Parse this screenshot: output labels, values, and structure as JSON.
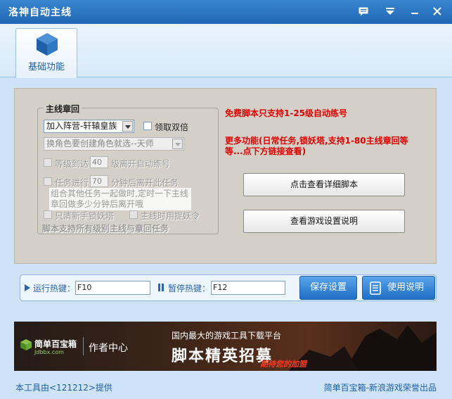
{
  "window": {
    "title": "洛神自动主线"
  },
  "tabs": [
    {
      "label": "基础功能"
    }
  ],
  "group": {
    "title": "主线章回",
    "camp_select": "加入阵营-轩辕皇族",
    "double_label": "领取双倍",
    "role_select": "换角色要创建角色就选--天师",
    "level_prefix": "等级到达",
    "level_value": "40",
    "level_suffix": "级离开自动练号",
    "task_prefix": "任务进行",
    "task_value": "70",
    "task_suffix": "分钟后离开此任务",
    "note": "组合其他任务一起做时,定时一下主线章回做多少分钟后离开哦",
    "only_lock_label": "只清新手锁妖塔",
    "catch_label": "主线时用捉妖令",
    "support_text": "脚本支持所有级别主线与章回任务"
  },
  "info": {
    "free_text": "免费脚本只支持1-25级自动练号",
    "more_text": "更多功能(日常任务,锁妖塔,支持1-80主线章回等等...点下方链接查看)"
  },
  "buttons": {
    "detail": "点击查看详细脚本",
    "instructions": "查看游戏设置说明",
    "save": "保存设置",
    "help": "使用说明"
  },
  "hotkeys": {
    "run_label": "运行热键：",
    "run_value": "F10",
    "pause_label": "暂停热键：",
    "pause_value": "F12"
  },
  "banner": {
    "logo_name": "简单百宝箱",
    "logo_url": "Jdbbx.com",
    "author_center": "作者中心",
    "headline_small": "国内最大的游戏工具下载平台",
    "headline_big": "脚本精英招募",
    "tagline": "期待您的加盟"
  },
  "footer": {
    "left": "本工具由<121212>提供",
    "right": "简单百宝箱-新浪游戏荣誉出品"
  },
  "colors": {
    "accent": "#1f66b5",
    "warning": "#e00000",
    "panel": "#d4d0c8"
  }
}
